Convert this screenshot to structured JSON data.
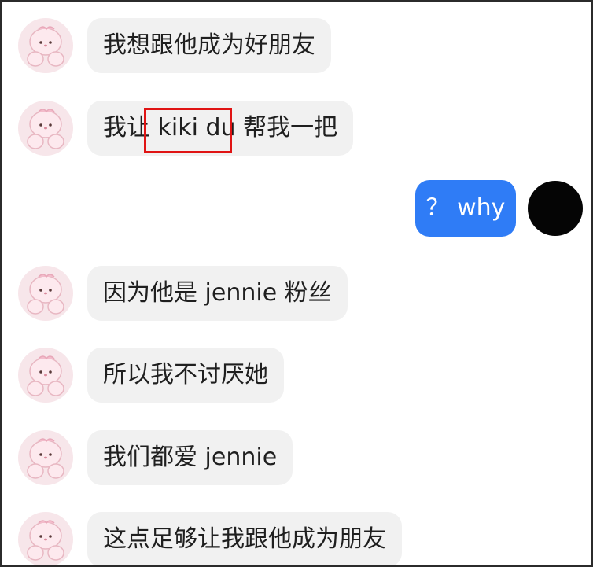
{
  "messages": [
    {
      "text": "我想跟他成为好朋友"
    },
    {
      "text_before": "我让 ",
      "text_highlight": "kiki du",
      "text_after": " 帮我一把"
    },
    {
      "text": "？ why"
    },
    {
      "text": "因为他是 jennie 粉丝"
    },
    {
      "text": "所以我不讨厌她"
    },
    {
      "text": "我们都爱 jennie"
    },
    {
      "text": "这点足够让我跟他成为朋友"
    }
  ],
  "colors": {
    "sent_bubble": "#2f7cf6",
    "received_bubble": "#f1f1f1",
    "highlight_box": "#e01414",
    "contact_avatar": "#f7e6ea",
    "own_avatar": "#050505"
  },
  "icons": {
    "contact_avatar": "pink-bunny-avatar-icon"
  }
}
